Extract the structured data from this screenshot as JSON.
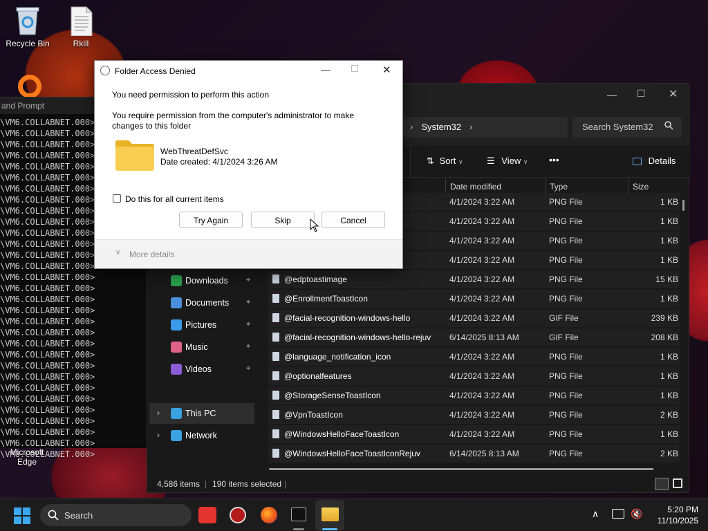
{
  "desktop": {
    "icons": [
      {
        "label": "Recycle Bin"
      },
      {
        "label": "Rkill"
      },
      {
        "label": "Microsoft Edge"
      }
    ]
  },
  "cmd": {
    "title": "and Prompt",
    "lines": [
      "\\VM6.COLLABNET.000>",
      "\\VM6.COLLABNET.000>",
      "\\VM6.COLLABNET.000>",
      "\\VM6.COLLABNET.000>",
      "\\VM6.COLLABNET.000>",
      "\\VM6.COLLABNET.000>",
      "\\VM6.COLLABNET.000>",
      "\\VM6.COLLABNET.000>",
      "\\VM6.COLLABNET.000>",
      "\\VM6.COLLABNET.000>",
      "\\VM6.COLLABNET.000>",
      "\\VM6.COLLABNET.000>",
      "\\VM6.COLLABNET.000>",
      "\\VM6.COLLABNET.000>",
      "\\VM6.COLLABNET.000>",
      "\\VM6.COLLABNET.000>",
      "\\VM6.COLLABNET.000>",
      "\\VM6.COLLABNET.000>",
      "\\VM6.COLLABNET.000>",
      "\\VM6.COLLABNET.000>",
      "\\VM6.COLLABNET.000>",
      "\\VM6.COLLABNET.000>",
      "\\VM6.COLLABNET.000>",
      "\\VM6.COLLABNET.000>",
      "\\VM6.COLLABNET.000>",
      "\\VM6.COLLABNET.000>",
      "\\VM6.COLLABNET.000>",
      "\\VM6.COLLABNET.000>",
      "\\VM6.COLLABNET.000>",
      "\\VM6.COLLABNET.000>",
      "\\VM6.COLLABNET.000>"
    ]
  },
  "explorer": {
    "breadcrumb": "System32",
    "search_placeholder": "Search System32",
    "toolbar": {
      "sort": "Sort",
      "view": "View",
      "more": "•••",
      "details": "Details"
    },
    "columns": {
      "date": "Date modified",
      "type": "Type",
      "size": "Size"
    },
    "nav": [
      {
        "label": "Downloads",
        "icon": "download-icon",
        "color": "#2ba24c"
      },
      {
        "label": "Documents",
        "icon": "documents-icon",
        "color": "#4a8fdc"
      },
      {
        "label": "Pictures",
        "icon": "pictures-icon",
        "color": "#3c9be8"
      },
      {
        "label": "Music",
        "icon": "music-icon",
        "color": "#e0608a"
      },
      {
        "label": "Videos",
        "icon": "videos-icon",
        "color": "#8b5ad6"
      },
      {
        "label": "This PC",
        "icon": "pc-icon",
        "color": "#3aa2e0"
      },
      {
        "label": "Network",
        "icon": "network-icon",
        "color": "#3aa2e0"
      }
    ],
    "files": [
      {
        "name": "",
        "date": "4/1/2024 3:22 AM",
        "type": "PNG File",
        "size": "1 KB"
      },
      {
        "name": "",
        "date": "4/1/2024 3:22 AM",
        "type": "PNG File",
        "size": "1 KB"
      },
      {
        "name": "",
        "date": "4/1/2024 3:22 AM",
        "type": "PNG File",
        "size": "1 KB"
      },
      {
        "name": "",
        "date": "4/1/2024 3:22 AM",
        "type": "PNG File",
        "size": "1 KB"
      },
      {
        "name": "@edptoastimage",
        "date": "4/1/2024 3:22 AM",
        "type": "PNG File",
        "size": "15 KB"
      },
      {
        "name": "@EnrollmentToastIcon",
        "date": "4/1/2024 3:22 AM",
        "type": "PNG File",
        "size": "1 KB"
      },
      {
        "name": "@facial-recognition-windows-hello",
        "date": "4/1/2024 3:22 AM",
        "type": "GIF File",
        "size": "239 KB"
      },
      {
        "name": "@facial-recognition-windows-hello-rejuv",
        "date": "6/14/2025 8:13 AM",
        "type": "GIF File",
        "size": "208 KB"
      },
      {
        "name": "@language_notification_icon",
        "date": "4/1/2024 3:22 AM",
        "type": "PNG File",
        "size": "1 KB"
      },
      {
        "name": "@optionalfeatures",
        "date": "4/1/2024 3:22 AM",
        "type": "PNG File",
        "size": "1 KB"
      },
      {
        "name": "@StorageSenseToastIcon",
        "date": "4/1/2024 3:22 AM",
        "type": "PNG File",
        "size": "1 KB"
      },
      {
        "name": "@VpnToastIcon",
        "date": "4/1/2024 3:22 AM",
        "type": "PNG File",
        "size": "2 KB"
      },
      {
        "name": "@WindowsHelloFaceToastIcon",
        "date": "4/1/2024 3:22 AM",
        "type": "PNG File",
        "size": "1 KB"
      },
      {
        "name": "@WindowsHelloFaceToastIconRejuv",
        "date": "6/14/2025 8:13 AM",
        "type": "PNG File",
        "size": "2 KB"
      }
    ],
    "status": {
      "items": "4,586 items",
      "selected": "190 items selected"
    }
  },
  "dialog": {
    "title": "Folder Access Denied",
    "heading": "You need permission to perform this action",
    "message": "You require permission from the computer's administrator to make changes to this folder",
    "folder_name": "WebThreatDefSvc",
    "folder_date": "Date created: 4/1/2024 3:26 AM",
    "checkbox_label": "Do this for all current items",
    "checkbox_checked": false,
    "buttons": {
      "try_again": "Try Again",
      "skip": "Skip",
      "cancel": "Cancel"
    },
    "more_details": "More details"
  },
  "taskbar": {
    "search_label": "Search",
    "time": "5:20 PM",
    "date": "11/10/2025"
  }
}
